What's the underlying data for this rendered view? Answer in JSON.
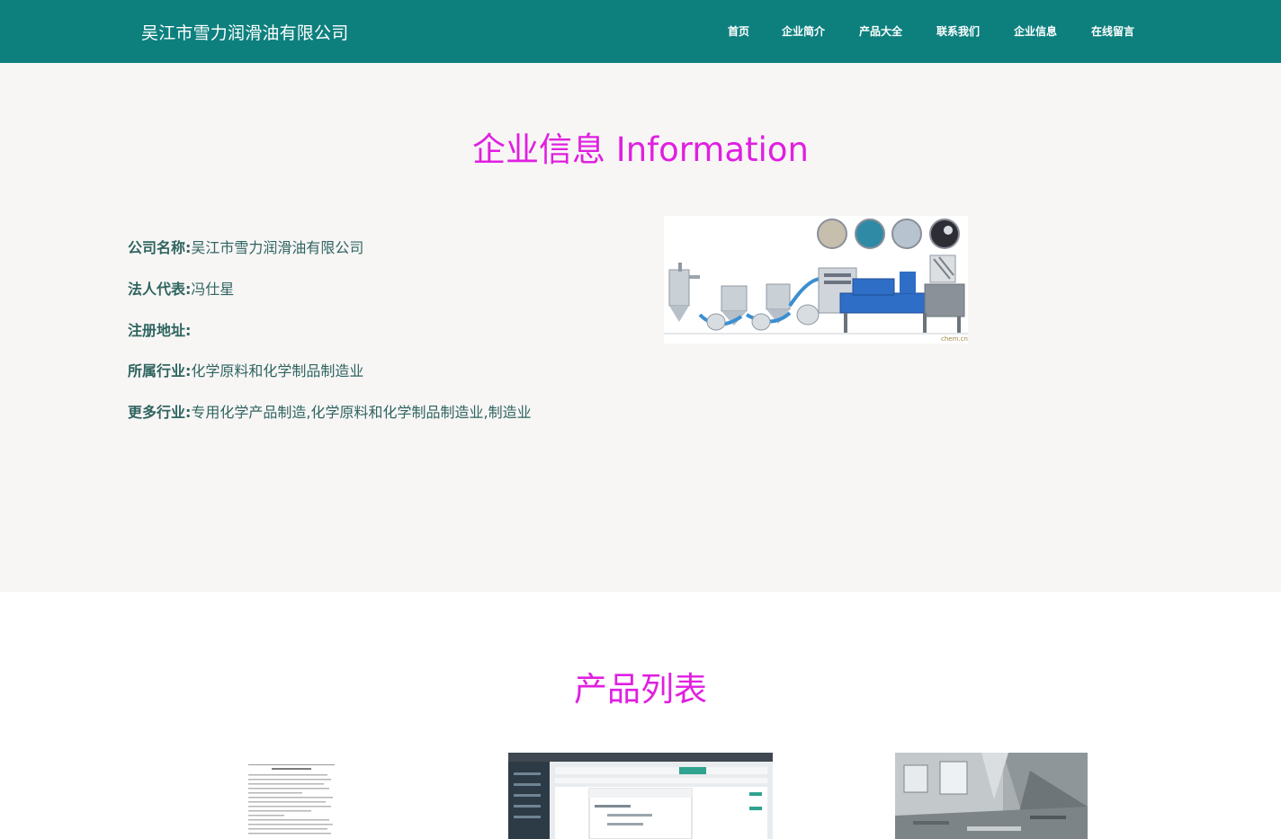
{
  "header": {
    "company_name": "吴江市雪力润滑油有限公司",
    "nav": [
      "首页",
      "企业简介",
      "产品大全",
      "联系我们",
      "企业信息",
      "在线留言"
    ]
  },
  "info": {
    "title": "企业信息 Information",
    "rows": [
      {
        "label": "公司名称:",
        "value": "吴江市雪力润滑油有限公司"
      },
      {
        "label": "法人代表:",
        "value": "冯仕星"
      },
      {
        "label": "注册地址:",
        "value": ""
      },
      {
        "label": "所属行业:",
        "value": "化学原料和化学制品制造业"
      },
      {
        "label": "更多行业:",
        "value": "专用化学产品制造,化学原料和化学制品制造业,制造业"
      }
    ],
    "image_watermark": "chem.cn"
  },
  "products": {
    "title": "产品列表"
  },
  "colors": {
    "header_bg": "#0d807e",
    "title_accent": "#e01fe0",
    "section_bg": "#f7f6f5",
    "label_text": "#2f6460"
  }
}
